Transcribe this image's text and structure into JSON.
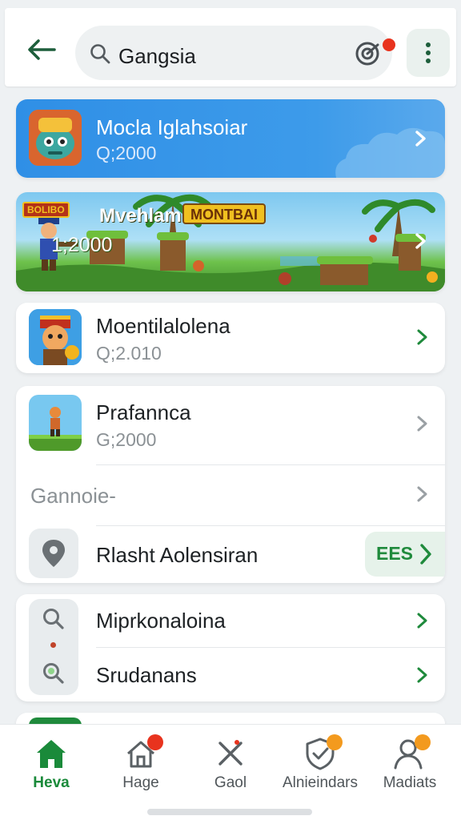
{
  "search": {
    "query": "Gangsia"
  },
  "featured": [
    {
      "title": "Mocla Iglahsoiar",
      "subtitle": "Q;2000"
    },
    {
      "title": "Mvehlam",
      "badge": "MONTBAI",
      "subtitle": "1;2000",
      "logo_text": "BOLIBO"
    }
  ],
  "list_items": [
    {
      "title": "Moentilalolena",
      "subtitle": "Q;2.010"
    },
    {
      "title": "Prafannca",
      "subtitle": "G;2000"
    }
  ],
  "section_label": "Gannoie-",
  "location_row": {
    "title": "Rlasht Aolensiran",
    "action": "EES"
  },
  "search_rows": [
    {
      "title": "Miprkonaloina"
    },
    {
      "title": "Srudanans"
    }
  ],
  "bottom_nav": [
    {
      "label": "Heva",
      "icon": "home-icon",
      "active": true
    },
    {
      "label": "Hage",
      "icon": "house-outline-icon"
    },
    {
      "label": "Gaol",
      "icon": "close-icon"
    },
    {
      "label": "Alnieindars",
      "icon": "shield-check-icon"
    },
    {
      "label": "Madiats",
      "icon": "person-icon"
    }
  ],
  "colors": {
    "accent": "#1a8a3a",
    "featured_blue": "#3590e6",
    "notification": "#e8331e"
  }
}
